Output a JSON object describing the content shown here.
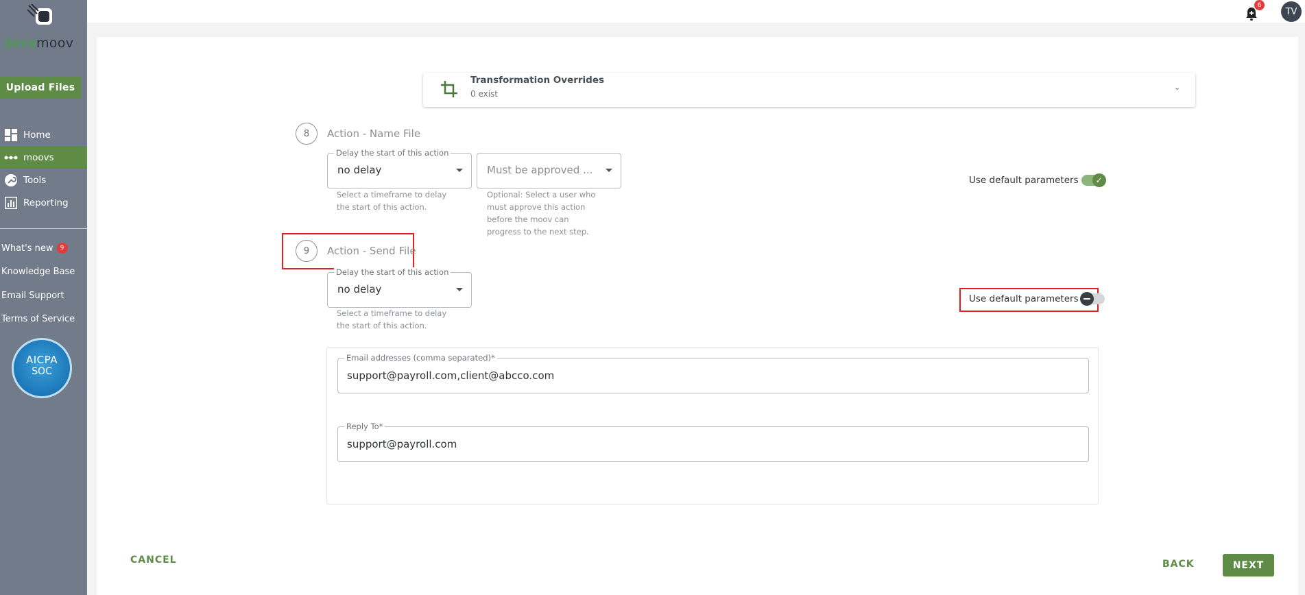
{
  "brand": {
    "logo_deco": "deco",
    "logo_moov": "moov",
    "accent": "#5e8c46"
  },
  "sidebar": {
    "upload_label": "Upload Files",
    "nav": [
      {
        "label": "Home",
        "icon": "dashboard-icon"
      },
      {
        "label": "moovs",
        "icon": "dots-icon"
      },
      {
        "label": "Tools",
        "icon": "wrench-icon"
      },
      {
        "label": "Reporting",
        "icon": "chart-icon"
      }
    ],
    "links": [
      {
        "label": "What's new",
        "badge": "9"
      },
      {
        "label": "Knowledge Base"
      },
      {
        "label": "Email Support"
      },
      {
        "label": "Terms of Service"
      }
    ],
    "cert": {
      "line1": "AICPA",
      "line2": "SOC"
    }
  },
  "topbar": {
    "notification_count": "6",
    "avatar_initials": "TV"
  },
  "overrides": {
    "title": "Transformation Overrides",
    "subtitle": "0 exist"
  },
  "step8": {
    "number": "8",
    "title": "Action - Name File",
    "delay_label": "Delay the start of this action",
    "delay_value": "no delay",
    "delay_helper_1": "Select a timeframe to delay",
    "delay_helper_2": "the start of this action.",
    "approver_value": "Must be approved ...",
    "approver_helper_1": "Optional: Select a user who",
    "approver_helper_2": "must approve this action",
    "approver_helper_3": "before the moov can",
    "approver_helper_4": "progress to the next step.",
    "default_params_label": "Use default parameters"
  },
  "step9": {
    "number": "9",
    "title": "Action - Send File",
    "delay_label": "Delay the start of this action",
    "delay_value": "no delay",
    "delay_helper_1": "Select a timeframe to delay",
    "delay_helper_2": "the start of this action.",
    "default_params_label": "Use default parameters",
    "email_label": "Email addresses (comma separated)*",
    "email_value": "support@payroll.com,client@abcco.com",
    "reply_label": "Reply To*",
    "reply_value": "support@payroll.com"
  },
  "footer": {
    "cancel": "CANCEL",
    "back": "BACK",
    "next": "NEXT"
  }
}
